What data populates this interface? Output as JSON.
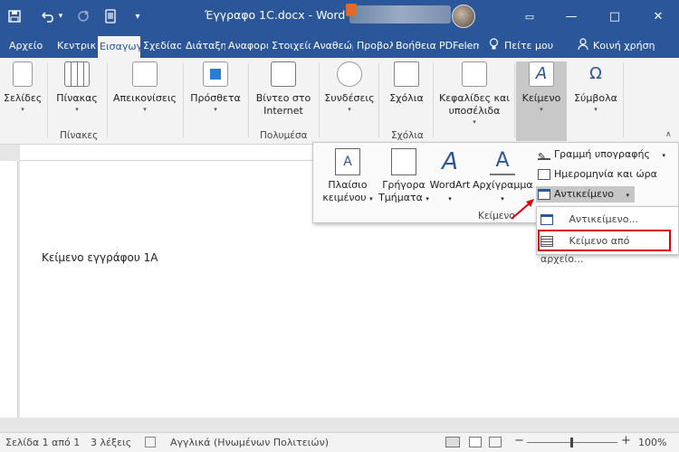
{
  "titlebar": {
    "title": "Έγγραφο 1C.docx - Word",
    "icons": [
      "save-icon",
      "undo-icon",
      "redo-icon",
      "touch-mode-icon",
      "customize-qat-icon"
    ],
    "undo_caret": "▾",
    "qat_caret": "▾",
    "minimize": "—",
    "restore": "□",
    "close": "✕",
    "ribbon_display": "▭"
  },
  "tabs": [
    "Αρχείο",
    "Κεντρική",
    "Εισαγωγή",
    "Σχεδίαση",
    "Διάταξη",
    "Αναφορές",
    "Στοιχεία",
    "Αναθεώρηση",
    "Προβολή",
    "Βοήθεια",
    "PDFelement",
    "Πείτε μου",
    "Κοινή χρήση"
  ],
  "ribbon": {
    "pages": "Σελίδες",
    "table": "Πίνακας",
    "tables_group": "Πίνακες",
    "illustrations": "Απεικονίσεις",
    "addins": "Πρόσθετα",
    "video_line1": "Βίντεο στο",
    "video_line2": "Internet",
    "media_group": "Πολυμέσα",
    "links": "Συνδέσεις",
    "comments": "Σχόλια",
    "comments_group": "Σχόλια",
    "header_line1": "Κεφαλίδες και",
    "header_line2": "υποσέλιδα",
    "text": "Κείμενο",
    "symbols": "Σύμβολα",
    "caret": "▾"
  },
  "flyout": {
    "textbox_line1": "Πλαίσιο",
    "textbox_line2": "κειμένου",
    "quickparts_line1": "Γρήγορα",
    "quickparts_line2": "Τμήματα",
    "wordart": "WordArt",
    "dropcap": "Αρχίγραμμα",
    "signature": "Γραμμή υπογραφής",
    "datetime": "Ημερομηνία και ώρα",
    "object": "Αντικείμενο",
    "group_label": "Κείμενο",
    "caret": "▾"
  },
  "submenu": {
    "object_item": "Αντικείμενο...",
    "text_from_file": "Κείμενο από αρχείο..."
  },
  "document": {
    "body_text": "Κείμενο εγγράφου 1Α"
  },
  "status": {
    "page": "Σελίδα 1 από 1",
    "words": "3 λέξεις",
    "language": "Αγγλικά (Ηνωμένων Πολιτειών)",
    "zoom": "100%",
    "zoom_minus": "−",
    "zoom_plus": "+"
  },
  "colors": {
    "accent": "#2b579a",
    "highlight": "#d9000e"
  }
}
